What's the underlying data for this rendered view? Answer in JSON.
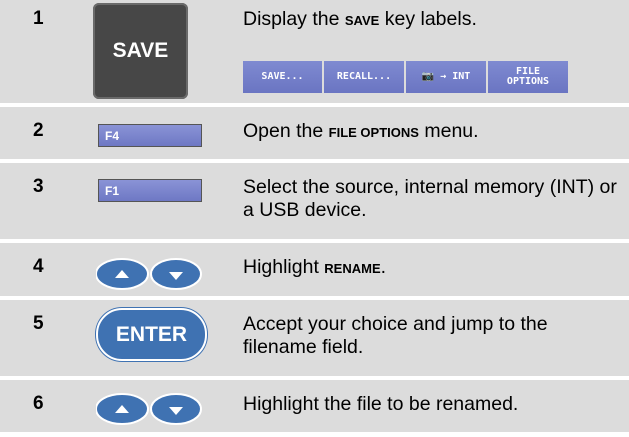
{
  "steps": [
    {
      "num": "1",
      "text_pre": "Display the ",
      "text_key": "SAVE",
      "text_post": " key labels.",
      "key_label": "SAVE",
      "softkeys": [
        "SAVE...",
        "RECALL...",
        "📷 → INT",
        "FILE OPTIONS"
      ],
      "softkey_line1": "FILE",
      "softkey_line2": "OPTIONS"
    },
    {
      "num": "2",
      "key_label": "F4",
      "text_pre": "Open the ",
      "text_key": "FILE OPTIONS",
      "text_post": " menu."
    },
    {
      "num": "3",
      "key_label": "F1",
      "text": "Select the source, internal memory (INT) or a USB device."
    },
    {
      "num": "4",
      "text_pre": "Highlight ",
      "text_key": "RENAME",
      "text_post": "."
    },
    {
      "num": "5",
      "key_label": "ENTER",
      "text": "Accept your choice and jump to the filename field."
    },
    {
      "num": "6",
      "text": "Highlight the file to be renamed."
    }
  ],
  "colors": {
    "row_bg": "#dcdcdc",
    "fkey_blue": "#6e78c4",
    "enter_blue": "#3f72b2",
    "save_key": "#474747"
  },
  "icons": {
    "up_arrow": "up-arrow-key-icon",
    "down_arrow": "down-arrow-key-icon",
    "camera": "camera-icon"
  }
}
